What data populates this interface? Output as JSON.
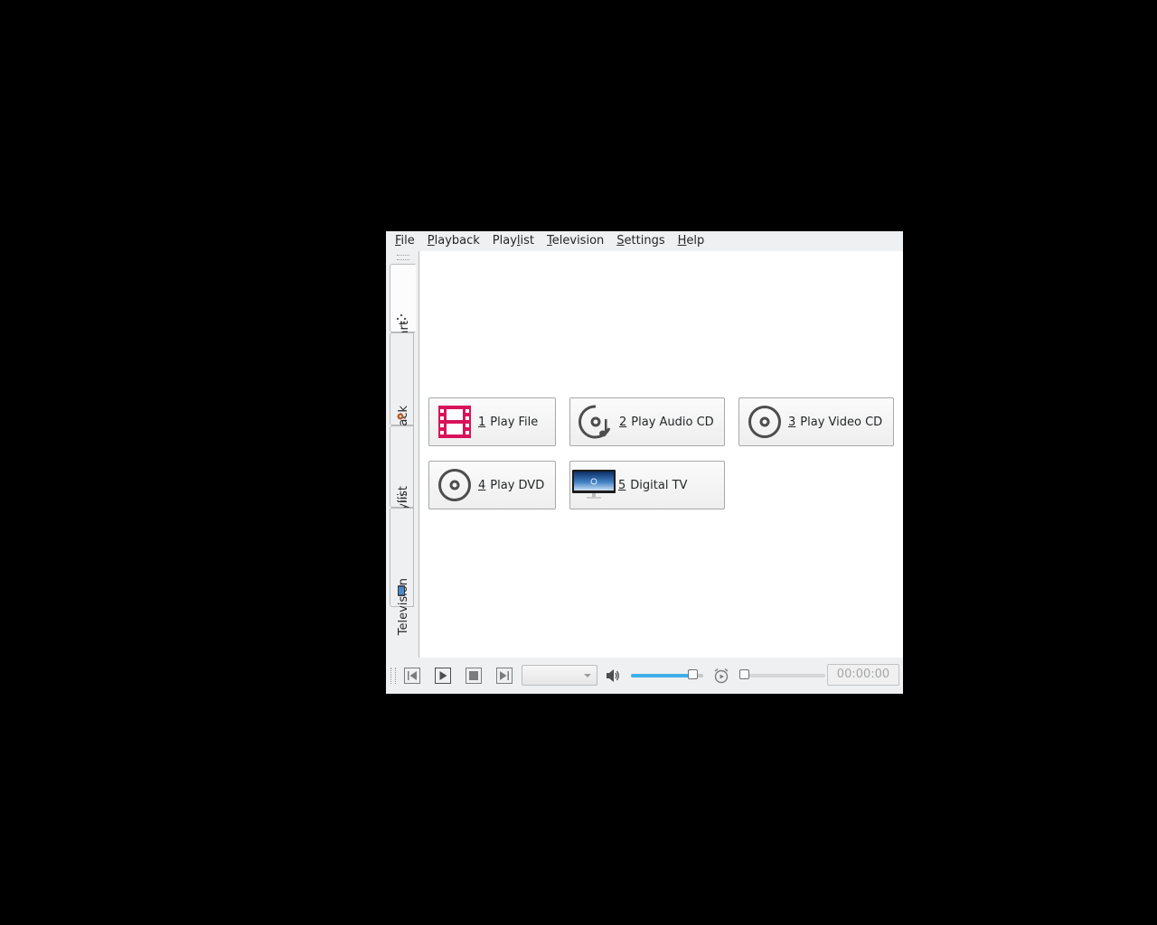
{
  "menubar": {
    "items": [
      {
        "label_u": "F",
        "label_rest": "ile"
      },
      {
        "label_u": "P",
        "label_rest": "layback"
      },
      {
        "label_pre": "Play",
        "label_u": "l",
        "label_rest": "ist"
      },
      {
        "label_u": "T",
        "label_rest": "elevision"
      },
      {
        "label_u": "S",
        "label_rest": "ettings"
      },
      {
        "label_u": "H",
        "label_rest": "elp"
      }
    ]
  },
  "sidebar": {
    "tabs": [
      {
        "label": "Start",
        "icon": "start-icon",
        "active": true
      },
      {
        "label": "Playback",
        "icon": "playback-icon",
        "active": false
      },
      {
        "label": "Playlist",
        "icon": "playlist-icon",
        "active": false
      },
      {
        "label": "Television",
        "icon": "television-icon",
        "active": false
      }
    ]
  },
  "actions": [
    {
      "num": "1",
      "label": "Play File",
      "icon": "film-icon"
    },
    {
      "num": "2",
      "label": "Play Audio CD",
      "icon": "audio-cd-icon"
    },
    {
      "num": "3",
      "label": "Play Video CD",
      "icon": "video-cd-icon"
    },
    {
      "num": "4",
      "label": "Play DVD",
      "icon": "dvd-icon"
    },
    {
      "num": "5",
      "label": "Digital TV",
      "icon": "tv-icon"
    }
  ],
  "toolbar": {
    "previous_icon": "skip-back-icon",
    "play_icon": "play-icon",
    "stop_icon": "stop-icon",
    "next_icon": "skip-forward-icon",
    "combo_value": "",
    "volume_level": 0.92,
    "seek_level": 0,
    "time": "00:00:00"
  },
  "colors": {
    "accent": "#3daee9",
    "film": "#d8135a",
    "icon_gray": "#4d4d4d"
  }
}
